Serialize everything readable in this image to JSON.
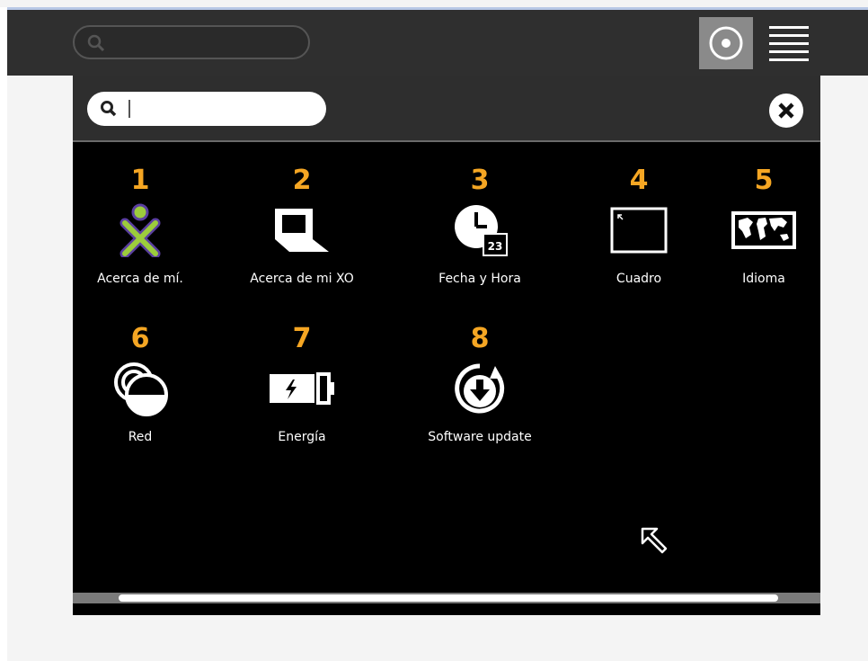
{
  "top_search": {
    "placeholder": ""
  },
  "panel_search": {
    "value": ""
  },
  "items": [
    {
      "num": "1",
      "label": "Acerca de mí.",
      "icon": "xo-person-icon"
    },
    {
      "num": "2",
      "label": "Acerca de mi XO",
      "icon": "laptop-icon"
    },
    {
      "num": "3",
      "label": "Fecha y Hora",
      "icon": "clock-icon",
      "badge": "23"
    },
    {
      "num": "4",
      "label": "Cuadro",
      "icon": "frame-icon"
    },
    {
      "num": "5",
      "label": "Idioma",
      "icon": "world-map-icon"
    },
    {
      "num": "6",
      "label": "Red",
      "icon": "network-icon"
    },
    {
      "num": "7",
      "label": "Energía",
      "icon": "battery-icon"
    },
    {
      "num": "8",
      "label": "Software update",
      "icon": "software-update-icon"
    }
  ],
  "colors": {
    "accent": "#f5a623",
    "panel": "#000000",
    "header": "#2e2e2e",
    "xo_stroke": "#9ccc3c",
    "xo_fill": "#5a3fa0"
  }
}
